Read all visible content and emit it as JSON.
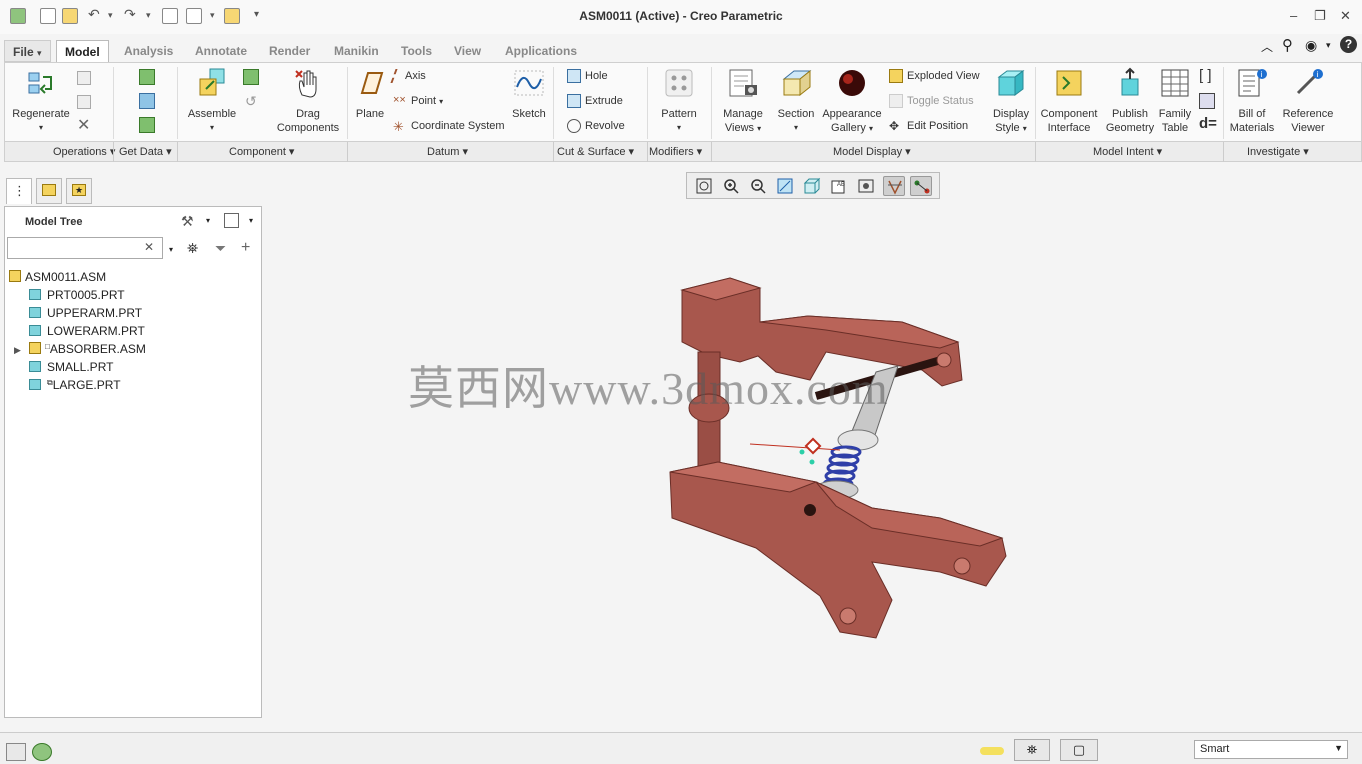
{
  "window": {
    "title": "ASM0011 (Active) - Creo Parametric"
  },
  "tabs": [
    {
      "label": "File",
      "caret": "▾"
    },
    {
      "label": "Model"
    },
    {
      "label": "Analysis"
    },
    {
      "label": "Annotate"
    },
    {
      "label": "Render"
    },
    {
      "label": "Manikin"
    },
    {
      "label": "Tools"
    },
    {
      "label": "View"
    },
    {
      "label": "Applications"
    }
  ],
  "ribbon": {
    "regenerate": "Regenerate",
    "assemble": "Assemble",
    "drag_components": [
      "Drag",
      "Components"
    ],
    "plane": "Plane",
    "axis": "Axis",
    "point": "Point",
    "coordinate_system": "Coordinate System",
    "sketch": "Sketch",
    "hole": "Hole",
    "extrude": "Extrude",
    "revolve": "Revolve",
    "pattern": "Pattern",
    "manage_views": [
      "Manage",
      "Views"
    ],
    "section": "Section",
    "appearance_gallery": [
      "Appearance",
      "Gallery"
    ],
    "exploded_view": "Exploded View",
    "toggle_status": "Toggle Status",
    "edit_position": "Edit Position",
    "display_style": [
      "Display",
      "Style"
    ],
    "component_interface": [
      "Component",
      "Interface"
    ],
    "publish_geometry": [
      "Publish",
      "Geometry"
    ],
    "family_table": [
      "Family",
      "Table"
    ],
    "bill_of_materials": [
      "Bill of",
      "Materials"
    ],
    "reference_viewer": [
      "Reference",
      "Viewer"
    ]
  },
  "groups": [
    "Operations",
    "Get Data",
    "Component",
    "Datum",
    "Cut & Surface",
    "Modifiers",
    "Model Display",
    "Model Intent",
    "Investigate"
  ],
  "model_tree": {
    "title": "Model Tree",
    "search_value": "",
    "items": [
      {
        "label": "ASM0011.ASM",
        "type": "asm",
        "level": 0
      },
      {
        "label": "PRT0005.PRT",
        "type": "prt",
        "level": 1
      },
      {
        "label": "UPPERARM.PRT",
        "type": "prt",
        "level": 1
      },
      {
        "label": "LOWERARM.PRT",
        "type": "prt",
        "level": 1
      },
      {
        "label": "ABSORBER.ASM",
        "type": "asm",
        "level": 1,
        "expandable": true
      },
      {
        "label": "SMALL.PRT",
        "type": "prt",
        "level": 1
      },
      {
        "label": "LARGE.PRT",
        "type": "prt",
        "level": 1
      }
    ]
  },
  "watermark": "莫西网www.3dmox.com",
  "status": {
    "filter": "Smart"
  },
  "colors": {
    "part": "#a8574d",
    "part_dark": "#7e3b33",
    "spring": "#2f3fa8",
    "accent_tab": "#ffffff"
  }
}
